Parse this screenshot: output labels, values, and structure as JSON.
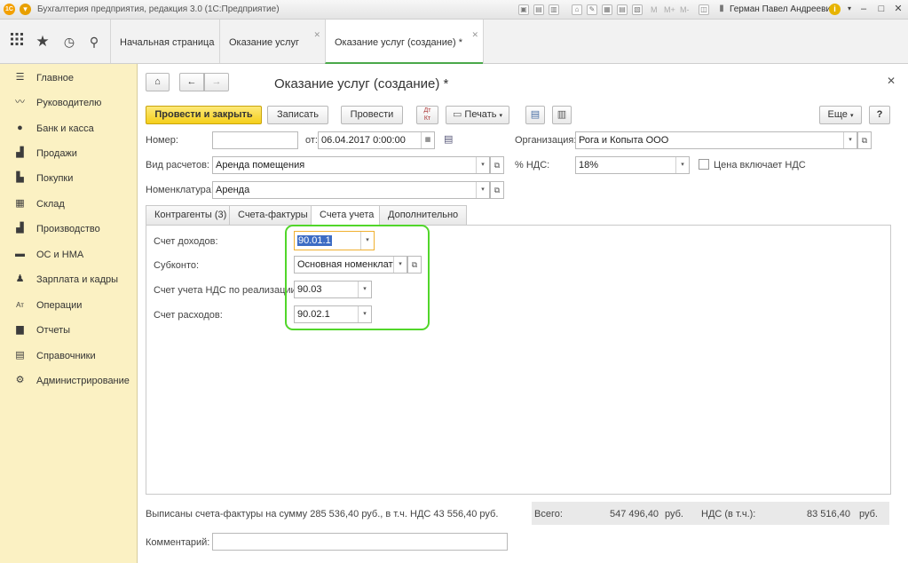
{
  "app": {
    "title": "Бухгалтерия предприятия, редакция 3.0  (1С:Предприятие)",
    "user": "Герман Павел Андреевич",
    "titlebar_labels": [
      "M",
      "M+",
      "M-"
    ]
  },
  "tabs": [
    {
      "label": "Начальная страница",
      "closable": false
    },
    {
      "label": "Оказание услуг",
      "closable": true
    },
    {
      "label": "Оказание услуг (создание) *",
      "closable": true
    }
  ],
  "sidebar": {
    "items": [
      {
        "label": "Главное",
        "icon": "list-icon"
      },
      {
        "label": "Руководителю",
        "icon": "trend-icon"
      },
      {
        "label": "Банк и касса",
        "icon": "coin-icon"
      },
      {
        "label": "Продажи",
        "icon": "bag-icon"
      },
      {
        "label": "Покупки",
        "icon": "cart-icon"
      },
      {
        "label": "Склад",
        "icon": "grid-icon"
      },
      {
        "label": "Производство",
        "icon": "factory-icon"
      },
      {
        "label": "ОС и НМА",
        "icon": "truck-icon"
      },
      {
        "label": "Зарплата и кадры",
        "icon": "person-icon"
      },
      {
        "label": "Операции",
        "icon": "dtkt-icon"
      },
      {
        "label": "Отчеты",
        "icon": "barchart-icon"
      },
      {
        "label": "Справочники",
        "icon": "books-icon"
      },
      {
        "label": "Администрирование",
        "icon": "gear-icon"
      }
    ]
  },
  "form": {
    "title": "Оказание услуг (создание) *",
    "buttons": {
      "post_close": "Провести и закрыть",
      "save": "Записать",
      "post": "Провести",
      "print": "Печать",
      "more": "Еще",
      "help": "?"
    },
    "fields": {
      "number_label": "Номер:",
      "number_value": "",
      "date_label": "от:",
      "date_value": "06.04.2017  0:00:00",
      "org_label": "Организация:",
      "org_value": "Рога и Копыта ООО",
      "calc_type_label": "Вид расчетов:",
      "calc_type_value": "Аренда помещения",
      "vat_label": "% НДС:",
      "vat_value": "18%",
      "price_incl_vat_label": "Цена включает НДС",
      "price_incl_vat_checked": false,
      "nomenclature_label": "Номенклатура:",
      "nomenclature_value": "Аренда"
    },
    "inner_tabs": [
      "Контрагенты (3)",
      "Счета-фактуры",
      "Счета учета",
      "Дополнительно"
    ],
    "accounts": {
      "income_label": "Счет доходов:",
      "income_value": "90.01.1",
      "subconto_label": "Субконто:",
      "subconto_value": "Основная номенклату",
      "vat_sales_label": "Счет учета НДС по реализации:",
      "vat_sales_value": "90.03",
      "expense_label": "Счет расходов:",
      "expense_value": "90.02.1"
    },
    "invoice_note": "Выписаны счета-фактуры на сумму 285 536,40 руб., в т.ч. НДС 43 556,40 руб.",
    "totals": {
      "total_label": "Всего:",
      "total_value": "547 496,40",
      "total_currency": "руб.",
      "vat_label": "НДС (в т.ч.):",
      "vat_value": "83 516,40",
      "vat_currency": "руб."
    },
    "comment_label": "Комментарий:",
    "comment_value": ""
  },
  "colors": {
    "sidebar_bg": "#fbf1c3",
    "primary_button": "#f5cf1b",
    "highlight_border": "#51d62a",
    "active_tab_underline": "#4aa84a",
    "focus_border": "#f0b030"
  }
}
